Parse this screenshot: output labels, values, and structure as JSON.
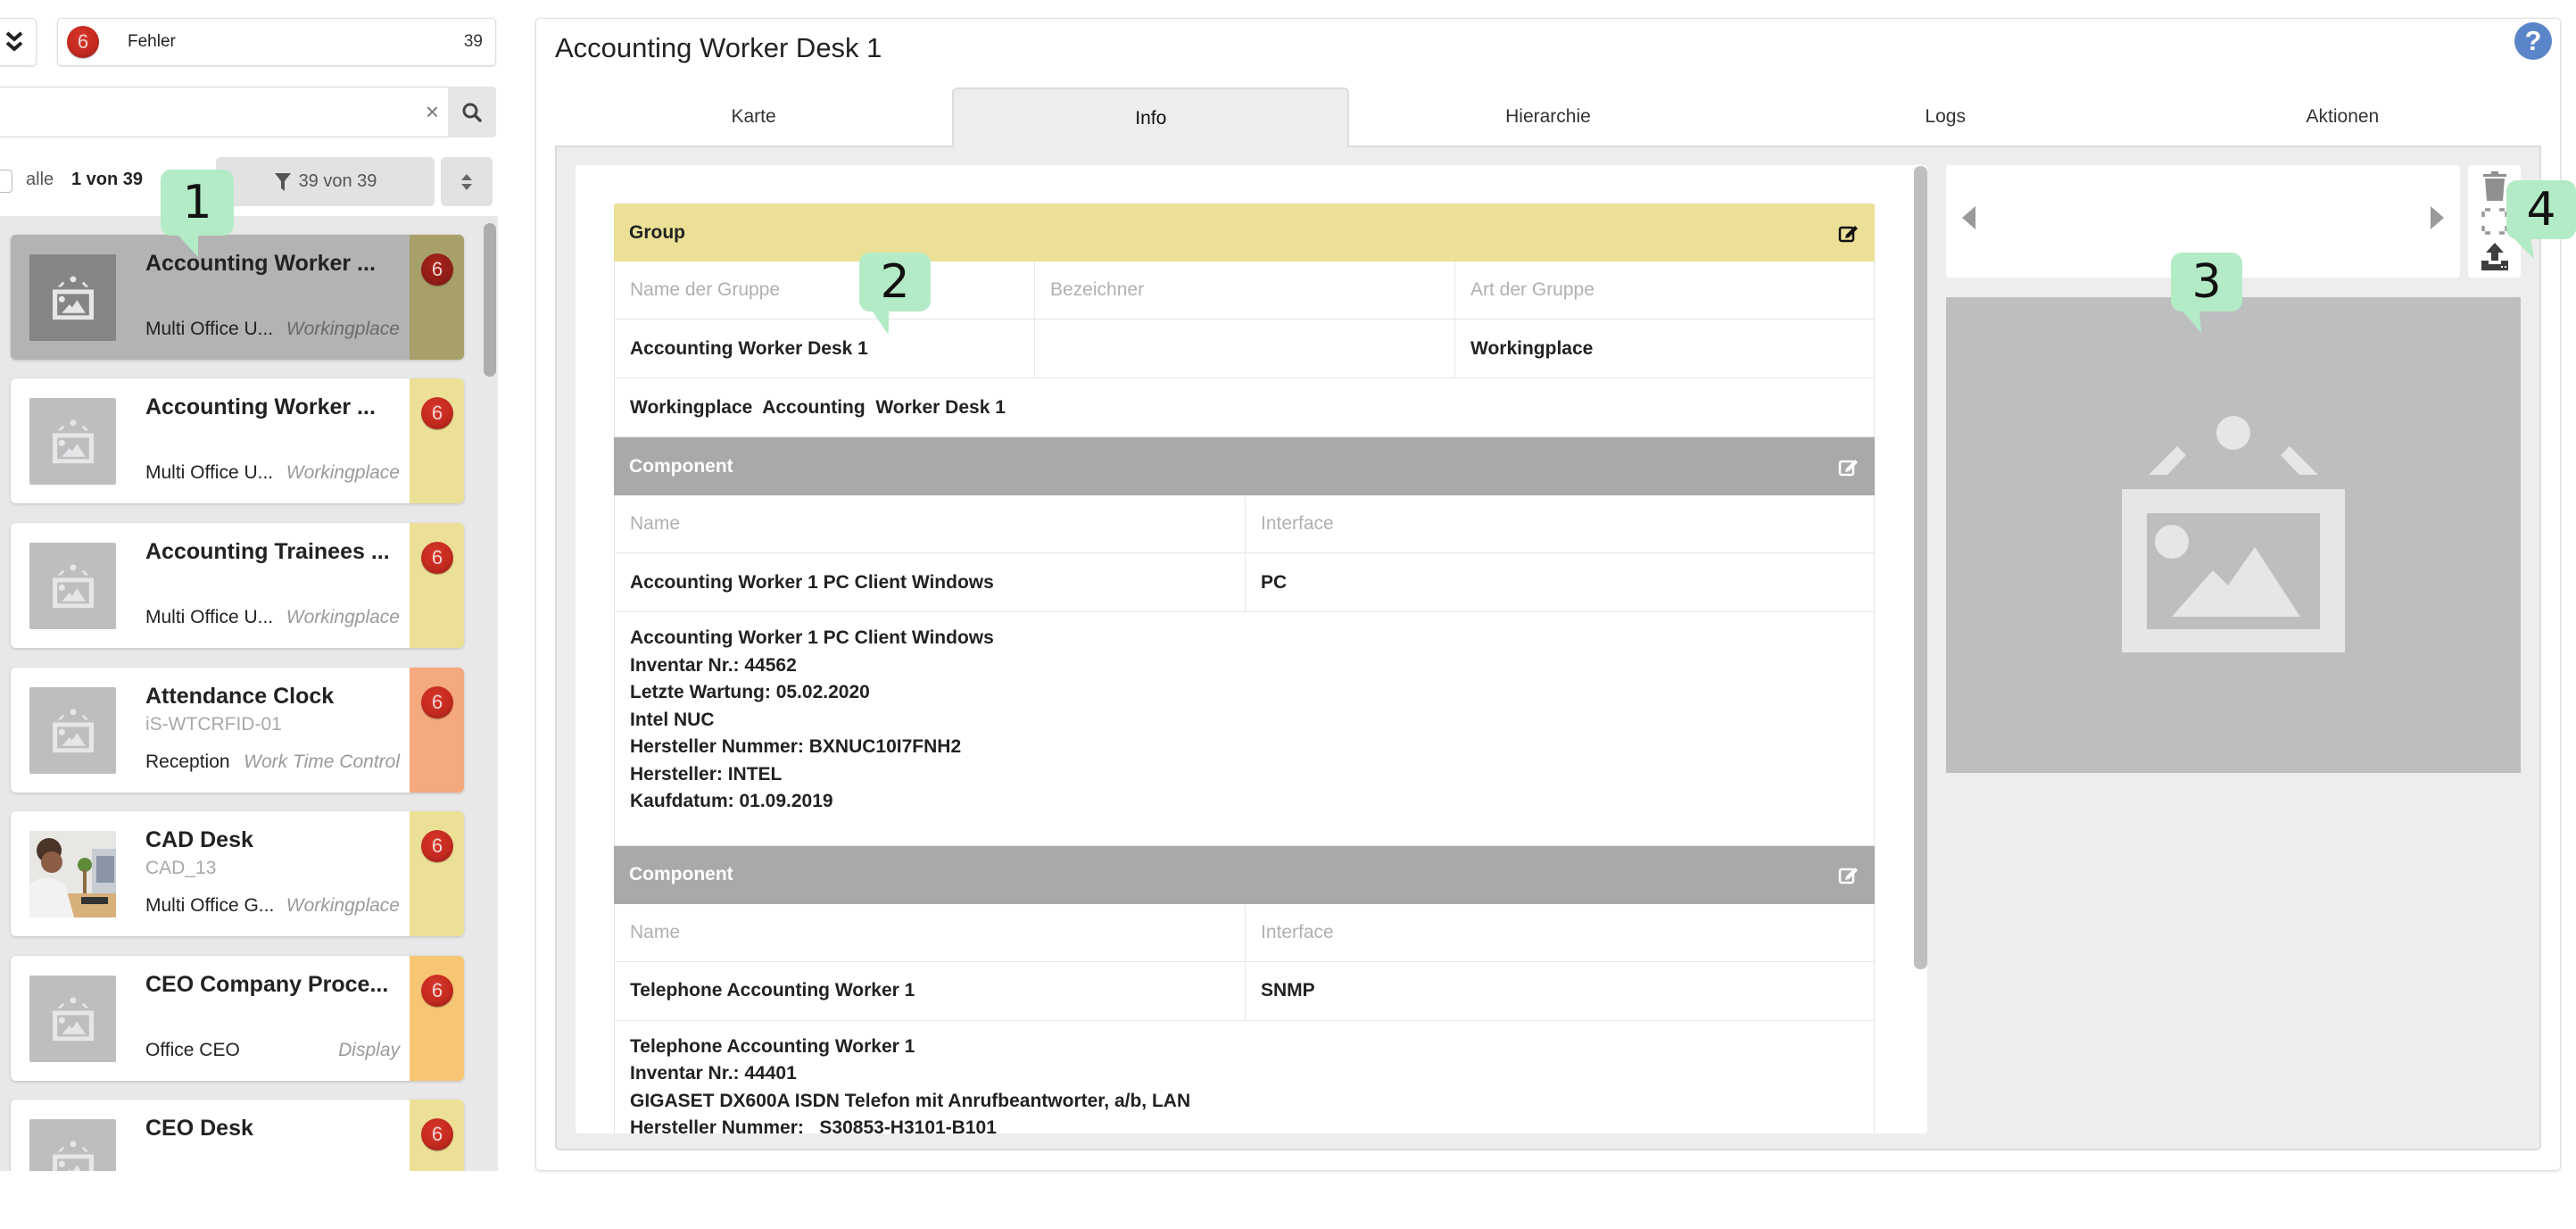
{
  "sidebar": {
    "error_filter": {
      "badge": "6",
      "label": "Fehler",
      "count": "39"
    },
    "search": {
      "value": "",
      "placeholder": ""
    },
    "select_all_label": "alle",
    "selection_count": "1 von 39",
    "filter_label": "39 von 39",
    "items": [
      {
        "title": "Accounting Worker ...",
        "subtitle": "",
        "location": "Multi Office U...",
        "type": "Workingplace",
        "badge": "6",
        "status_color": "#a8a06a",
        "selected": true,
        "has_photo": false
      },
      {
        "title": "Accounting Worker ...",
        "subtitle": "",
        "location": "Multi Office U...",
        "type": "Workingplace",
        "badge": "6",
        "status_color": "#ece097",
        "selected": false,
        "has_photo": false
      },
      {
        "title": "Accounting Trainees ...",
        "subtitle": "",
        "location": "Multi Office U...",
        "type": "Workingplace",
        "badge": "6",
        "status_color": "#ece097",
        "selected": false,
        "has_photo": false
      },
      {
        "title": "Attendance Clock",
        "subtitle": "iS-WTCRFID-01",
        "location": "Reception",
        "type": "Work Time Control",
        "badge": "6",
        "status_color": "#f4a97f",
        "selected": false,
        "has_photo": false
      },
      {
        "title": "CAD Desk",
        "subtitle": "CAD_13",
        "location": "Multi Office G...",
        "type": "Workingplace",
        "badge": "6",
        "status_color": "#ece097",
        "selected": false,
        "has_photo": true
      },
      {
        "title": "CEO Company Proce...",
        "subtitle": "",
        "location": "Office CEO",
        "type": "Display",
        "badge": "6",
        "status_color": "#f6c675",
        "selected": false,
        "has_photo": false
      },
      {
        "title": "CEO Desk",
        "subtitle": "",
        "location": "",
        "type": "",
        "badge": "6",
        "status_color": "#ece097",
        "selected": false,
        "has_photo": false
      }
    ]
  },
  "main": {
    "title": "Accounting Worker Desk 1",
    "tabs": [
      {
        "label": "Karte",
        "active": false
      },
      {
        "label": "Info",
        "active": true
      },
      {
        "label": "Hierarchie",
        "active": false
      },
      {
        "label": "Logs",
        "active": false
      },
      {
        "label": "Aktionen",
        "active": false
      }
    ],
    "group": {
      "header": "Group",
      "columns": [
        "Name der Gruppe",
        "Bezeichner",
        "Art der Gruppe"
      ],
      "values": [
        "Accounting Worker Desk 1",
        "",
        "Workingplace"
      ],
      "description": "Workingplace  Accounting  Worker Desk 1"
    },
    "components": [
      {
        "header": "Component",
        "columns": [
          "Name",
          "Interface"
        ],
        "values": [
          "Accounting Worker 1 PC Client Windows",
          "PC"
        ],
        "description_lines": [
          "Accounting Worker 1 PC Client Windows",
          "Inventar Nr.: 44562",
          "Letzte Wartung: 05.02.2020",
          "Intel NUC",
          "Hersteller Nummer: BXNUC10I7FNH2",
          "Hersteller: INTEL",
          "Kaufdatum: 01.09.2019"
        ]
      },
      {
        "header": "Component",
        "columns": [
          "Name",
          "Interface"
        ],
        "values": [
          "Telephone Accounting Worker 1",
          "SNMP"
        ],
        "description_lines": [
          "Telephone Accounting Worker 1",
          "Inventar Nr.: 44401",
          "GIGASET DX600A ISDN Telefon mit Anrufbeantworter, a/b, LAN",
          "Hersteller Nummer:   S30853-H3101-B101"
        ]
      }
    ]
  },
  "image_panel": {
    "actions": [
      "delete-icon",
      "fullscreen-icon",
      "upload-icon"
    ]
  },
  "callouts": [
    "1",
    "2",
    "3",
    "4"
  ],
  "colors": {
    "badge_red": "#c42a20",
    "group_header": "#ece097",
    "component_header": "#a9a9a9",
    "help_blue": "#5b85c9",
    "callout_green": "#b2ebc5"
  }
}
